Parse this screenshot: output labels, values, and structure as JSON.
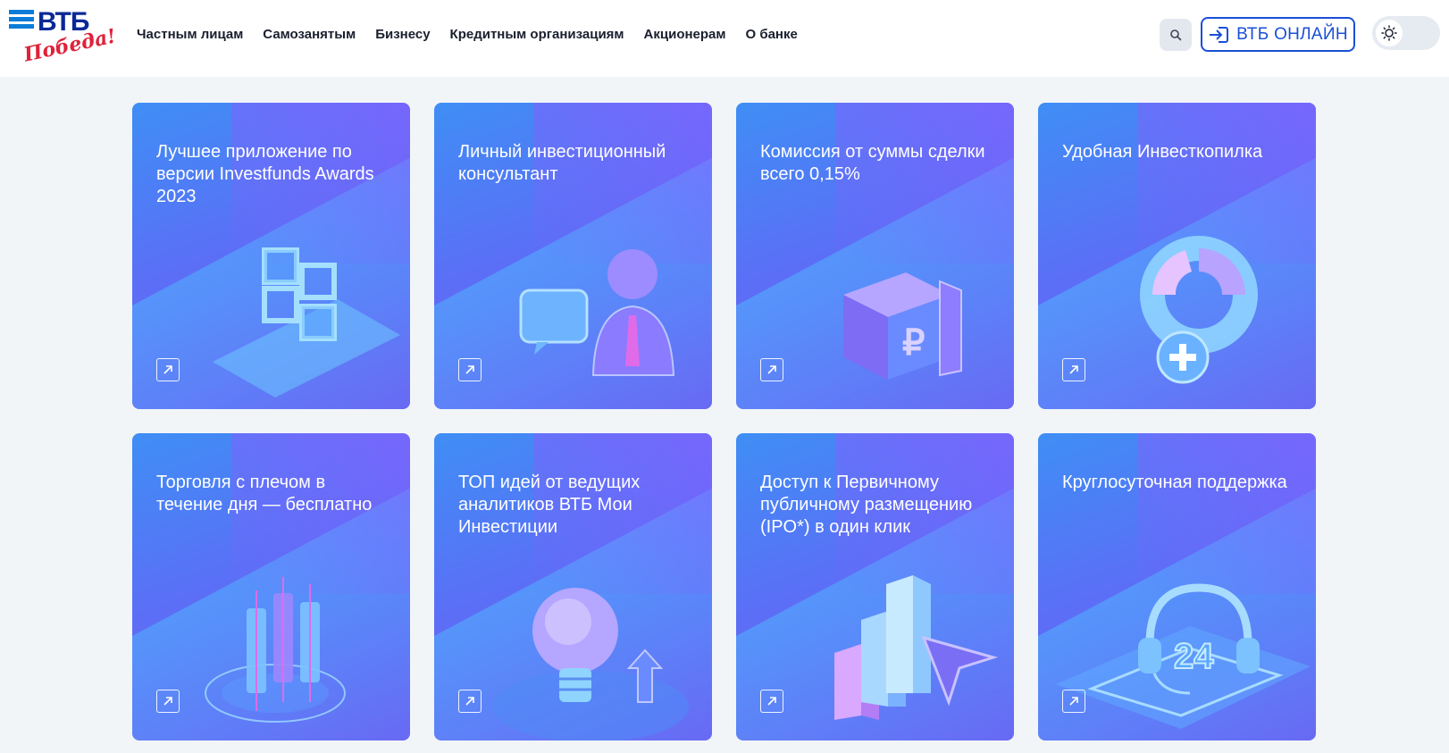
{
  "header": {
    "logo_text": "ВТБ",
    "logo_script": "Победа!",
    "nav": [
      "Частным лицам",
      "Самозанятым",
      "Бизнесу",
      "Кредитным организациям",
      "Акционерам",
      "О банке"
    ],
    "online_label": "ВТБ ОНЛАЙН"
  },
  "cards": [
    {
      "title": "Лучшее приложение по версии Investfunds Awards 2023",
      "art": "blocks"
    },
    {
      "title": "Личный инвестиционный консультант",
      "art": "consultant"
    },
    {
      "title": "Комиссия от суммы сделки всего 0,15%",
      "art": "safe"
    },
    {
      "title": "Удобная Инвесткопилка",
      "art": "piechart"
    },
    {
      "title": "Торговля с плечом в течение дня — бесплатно",
      "art": "candles"
    },
    {
      "title": "ТОП идей от ведущих аналитиков ВТБ Мои Инвестиции",
      "art": "bulb"
    },
    {
      "title": "Доступ к Первичному публичному размещению (IPO*) в один клик",
      "art": "bars"
    },
    {
      "title": "Круглосуточная поддержка",
      "art": "headset"
    }
  ],
  "colors": {
    "brand_blue": "#0a2896",
    "accent_blue": "#1a4fd8",
    "logo_red": "#e0213a"
  }
}
